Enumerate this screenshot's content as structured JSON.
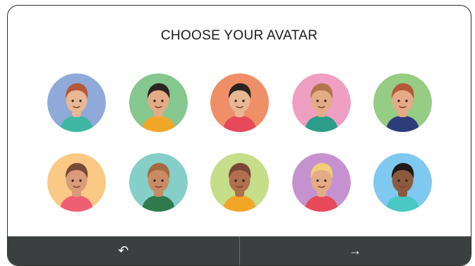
{
  "header": {
    "title": "CHOOSE YOUR AVATAR"
  },
  "avatars": [
    {
      "name": "avatar-1",
      "bg": "#8fa9d8",
      "skin": "#e8b795",
      "hair": "#b5583a",
      "shirt": "#3fb7a4"
    },
    {
      "name": "avatar-2",
      "bg": "#86c68f",
      "skin": "#e3ab86",
      "hair": "#2c2523",
      "shirt": "#f2a628"
    },
    {
      "name": "avatar-3",
      "bg": "#ef8f68",
      "skin": "#e8b795",
      "hair": "#2a2420",
      "shirt": "#e6495a"
    },
    {
      "name": "avatar-4",
      "bg": "#ef9fc2",
      "skin": "#e3ab86",
      "hair": "#b3754d",
      "shirt": "#2b9d89"
    },
    {
      "name": "avatar-5",
      "bg": "#97cc84",
      "skin": "#e3ab86",
      "hair": "#b5583a",
      "shirt": "#2c3d7a"
    },
    {
      "name": "avatar-6",
      "bg": "#f9c985",
      "skin": "#d99b7a",
      "hair": "#7a4836",
      "shirt": "#f05e73"
    },
    {
      "name": "avatar-7",
      "bg": "#86cfc9",
      "skin": "#c98a66",
      "hair": "#a56a3f",
      "shirt": "#2f7a4c"
    },
    {
      "name": "avatar-8",
      "bg": "#c6dd8a",
      "skin": "#b06f4e",
      "hair": "#7a4836",
      "shirt": "#f2a628"
    },
    {
      "name": "avatar-9",
      "bg": "#c591cf",
      "skin": "#e3ab86",
      "hair": "#f0cd7a",
      "shirt": "#e6495a"
    },
    {
      "name": "avatar-10",
      "bg": "#7fc8ef",
      "skin": "#8b5a3f",
      "hair": "#1e1a1a",
      "shirt": "#49c8c4"
    }
  ],
  "footer": {
    "back_icon": "undo-arrow",
    "back_glyph": "↶",
    "next_icon": "arrow-right",
    "next_glyph": "→"
  }
}
